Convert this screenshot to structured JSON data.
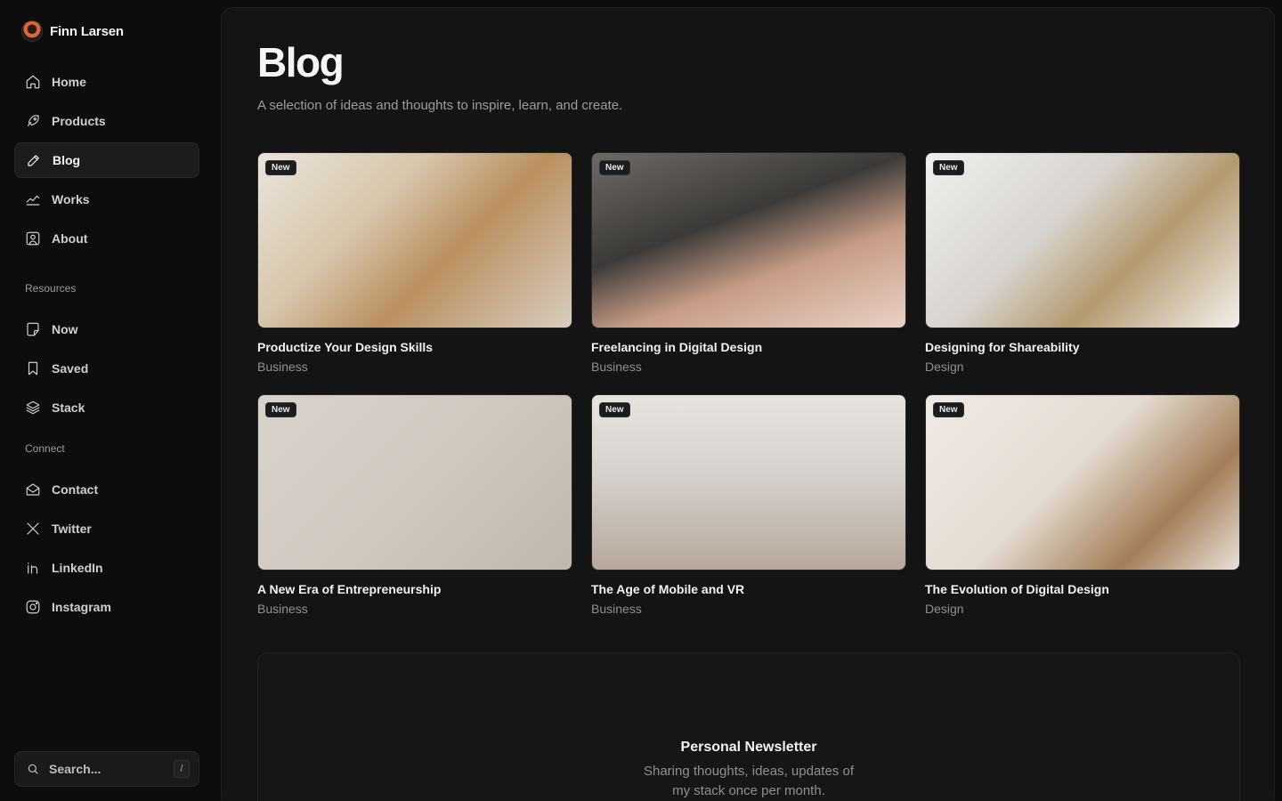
{
  "brand": {
    "name": "Finn Larsen"
  },
  "nav": {
    "main": [
      {
        "label": "Home",
        "icon": "home-icon"
      },
      {
        "label": "Products",
        "icon": "rocket-icon"
      },
      {
        "label": "Blog",
        "icon": "pen-icon",
        "active": true
      },
      {
        "label": "Works",
        "icon": "chart-icon"
      },
      {
        "label": "About",
        "icon": "user-square-icon"
      }
    ],
    "resources_label": "Resources",
    "resources": [
      {
        "label": "Now",
        "icon": "note-icon"
      },
      {
        "label": "Saved",
        "icon": "bookmark-icon"
      },
      {
        "label": "Stack",
        "icon": "layers-icon"
      }
    ],
    "connect_label": "Connect",
    "connect": [
      {
        "label": "Contact",
        "icon": "mail-open-icon"
      },
      {
        "label": "Twitter",
        "icon": "x-icon"
      },
      {
        "label": "LinkedIn",
        "icon": "linkedin-icon"
      },
      {
        "label": "Instagram",
        "icon": "instagram-icon"
      }
    ]
  },
  "search": {
    "placeholder": "Search...",
    "shortcut": "/"
  },
  "page": {
    "title": "Blog",
    "subtitle": "A selection of ideas and thoughts to inspire, learn, and create."
  },
  "posts": [
    {
      "badge": "New",
      "title": "Productize Your Design Skills",
      "category": "Business"
    },
    {
      "badge": "New",
      "title": "Freelancing in Digital Design",
      "category": "Business"
    },
    {
      "badge": "New",
      "title": "Designing for Shareability",
      "category": "Design"
    },
    {
      "badge": "New",
      "title": "A New Era of Entrepreneurship",
      "category": "Business"
    },
    {
      "badge": "New",
      "title": "The Age of Mobile and VR",
      "category": "Business"
    },
    {
      "badge": "New",
      "title": " The Evolution of Digital Design",
      "category": "Design"
    }
  ],
  "newsletter": {
    "title": "Personal Newsletter",
    "text": "Sharing thoughts, ideas, updates of my stack once per month."
  },
  "colors": {
    "background": "#0d0d0d",
    "panel": "#141414",
    "active_nav": "#1c1c1c"
  }
}
